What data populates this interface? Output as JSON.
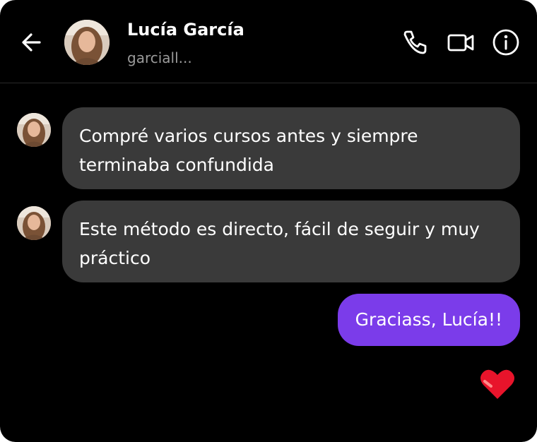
{
  "header": {
    "contact_name": "Lucía García",
    "username": "garciall..."
  },
  "icons": {
    "back": "arrow-left-icon",
    "phone": "phone-icon",
    "video": "video-camera-icon",
    "info": "info-icon",
    "reaction": "heart-icon"
  },
  "messages": [
    {
      "from": "contact",
      "text": "Compré varios cursos antes y siempre terminaba confundida"
    },
    {
      "from": "contact",
      "text": "Este método es directo, fácil de seguir y muy práctico"
    },
    {
      "from": "me",
      "text": "Graciass, Lucía!!"
    }
  ],
  "colors": {
    "background": "#000000",
    "incoming_bubble": "#3a3a3a",
    "outgoing_bubble": "#7b3cea",
    "heart": "#e8142b"
  }
}
